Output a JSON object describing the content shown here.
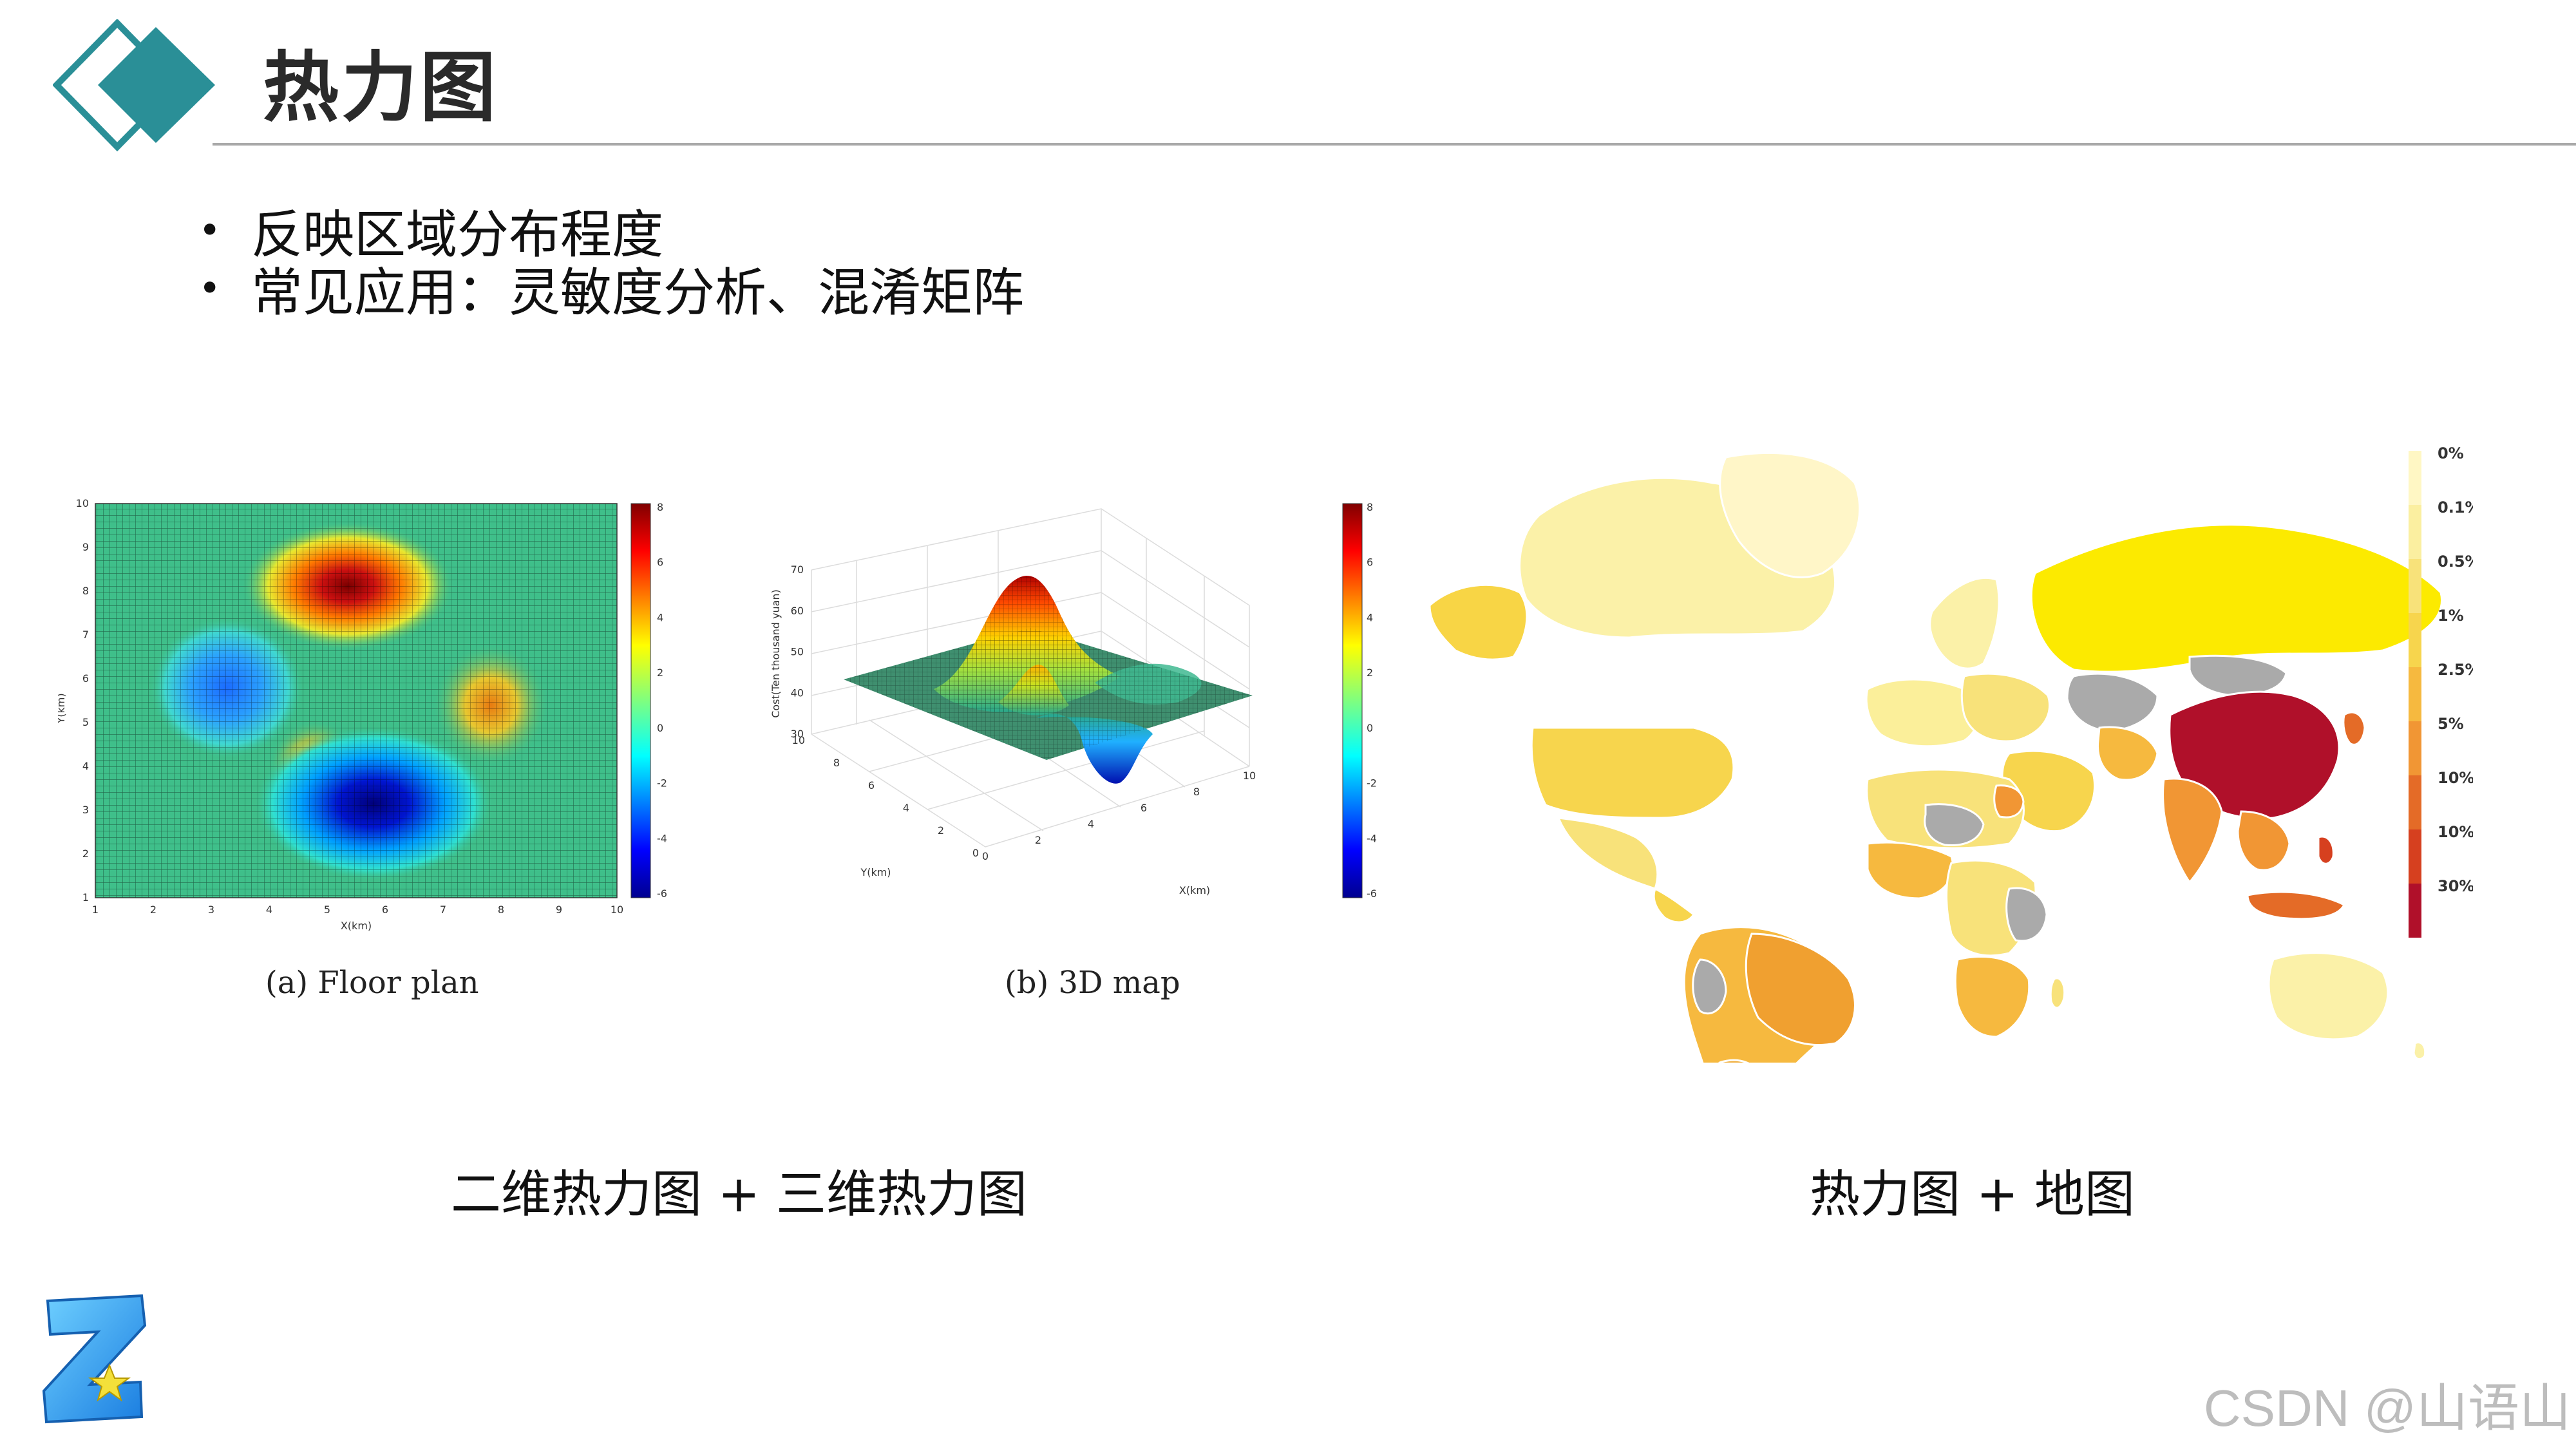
{
  "slide": {
    "title": "热力图",
    "bullets": [
      "反映区域分布程度",
      "常见应用：灵敏度分析、混淆矩阵"
    ],
    "watermark": "CSDN @山语山",
    "accent_color": "#2a8f97"
  },
  "figures": {
    "floor_plan": {
      "caption": "(a) Floor plan",
      "xlabel": "X(km)",
      "ylabel": "Y(km)",
      "x_ticks": [
        "1",
        "2",
        "3",
        "4",
        "5",
        "6",
        "7",
        "8",
        "9",
        "10"
      ],
      "y_ticks": [
        "1",
        "2",
        "3",
        "4",
        "5",
        "6",
        "7",
        "8",
        "9",
        "10"
      ],
      "colorbar_ticks": [
        "8",
        "6",
        "4",
        "2",
        "0",
        "-2",
        "-4",
        "-6"
      ]
    },
    "map_3d": {
      "caption": "(b) 3D map",
      "xlabel": "X(km)",
      "ylabel": "Y(km)",
      "zlabel": "Cost(Ten thousand yuan)",
      "z_ticks": [
        "70",
        "60",
        "50",
        "40",
        "30"
      ],
      "x_ticks": [
        "0",
        "2",
        "4",
        "6",
        "8",
        "10"
      ],
      "y_ticks": [
        "10",
        "8",
        "6",
        "4",
        "2",
        "0"
      ],
      "colorbar_ticks": [
        "8",
        "6",
        "4",
        "2",
        "0",
        "-2",
        "-4",
        "-6"
      ]
    },
    "world_map": {
      "legend": [
        "0%",
        "0.1%",
        "0.5%",
        "1%",
        "2.5%",
        "5%",
        "10%",
        "10%",
        "30%"
      ],
      "legend_colors": [
        "#fff7c4",
        "#fbefa0",
        "#f8e27a",
        "#f7d54d",
        "#f6b93f",
        "#f19634",
        "#e46b27",
        "#d6401f",
        "#b0102a"
      ]
    }
  },
  "captions": {
    "left": "二维热力图 + 三维热力图",
    "right": "热力图 + 地图"
  },
  "chart_data": [
    {
      "type": "heatmap",
      "title": "(a) Floor plan",
      "xlabel": "X(km)",
      "ylabel": "Y(km)",
      "xlim": [
        1,
        10
      ],
      "ylim": [
        1,
        10
      ],
      "zlim": [
        -6,
        8
      ],
      "colormap": "jet",
      "features": [
        {
          "x": 5.5,
          "y": 8.2,
          "value": 8
        },
        {
          "x": 3.5,
          "y": 6.1,
          "value": -3
        },
        {
          "x": 4.8,
          "y": 4.8,
          "value": 3
        },
        {
          "x": 7.7,
          "y": 5.9,
          "value": 3.5
        },
        {
          "x": 5.8,
          "y": 3.0,
          "value": -6
        }
      ]
    },
    {
      "type": "area",
      "title": "(b) 3D map",
      "xlabel": "X(km)",
      "ylabel": "Y(km)",
      "zlabel": "Cost(Ten thousand yuan)",
      "xlim": [
        0,
        10
      ],
      "ylim": [
        0,
        10
      ],
      "zlim": [
        30,
        70
      ],
      "colorbar_range": [
        -6,
        8
      ]
    }
  ]
}
